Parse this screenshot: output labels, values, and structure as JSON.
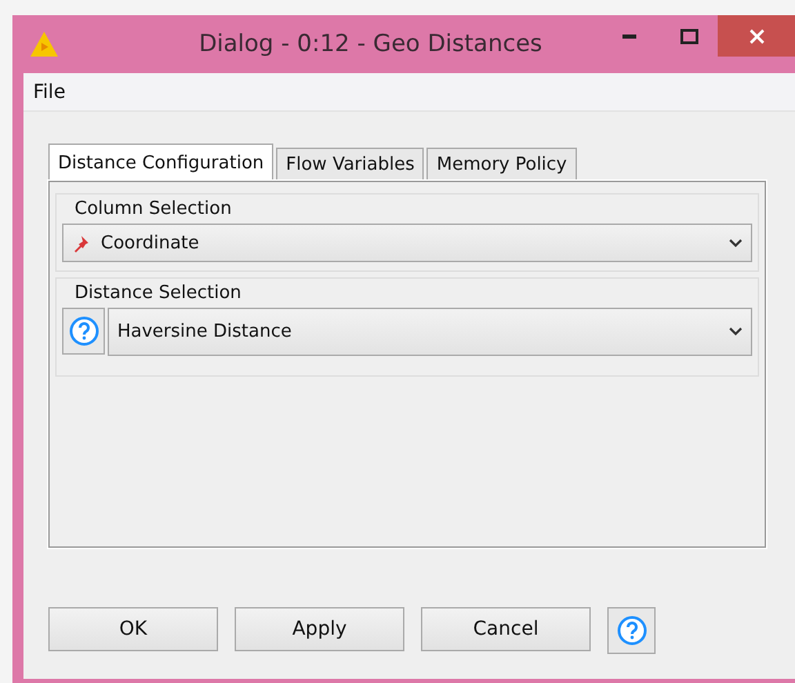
{
  "window": {
    "title": "Dialog - 0:12 - Geo Distances"
  },
  "menu": [
    "File"
  ],
  "tabs": [
    {
      "label": "Distance Configuration",
      "selected": true
    },
    {
      "label": "Flow Variables",
      "selected": false
    },
    {
      "label": "Memory Policy",
      "selected": false
    }
  ],
  "groups": [
    {
      "title": "Column Selection",
      "kind": "column",
      "value": "Coordinate"
    },
    {
      "title": "Distance Selection",
      "kind": "distance",
      "value": "Haversine Distance"
    }
  ],
  "buttons": [
    "OK",
    "Apply",
    "Cancel"
  ]
}
